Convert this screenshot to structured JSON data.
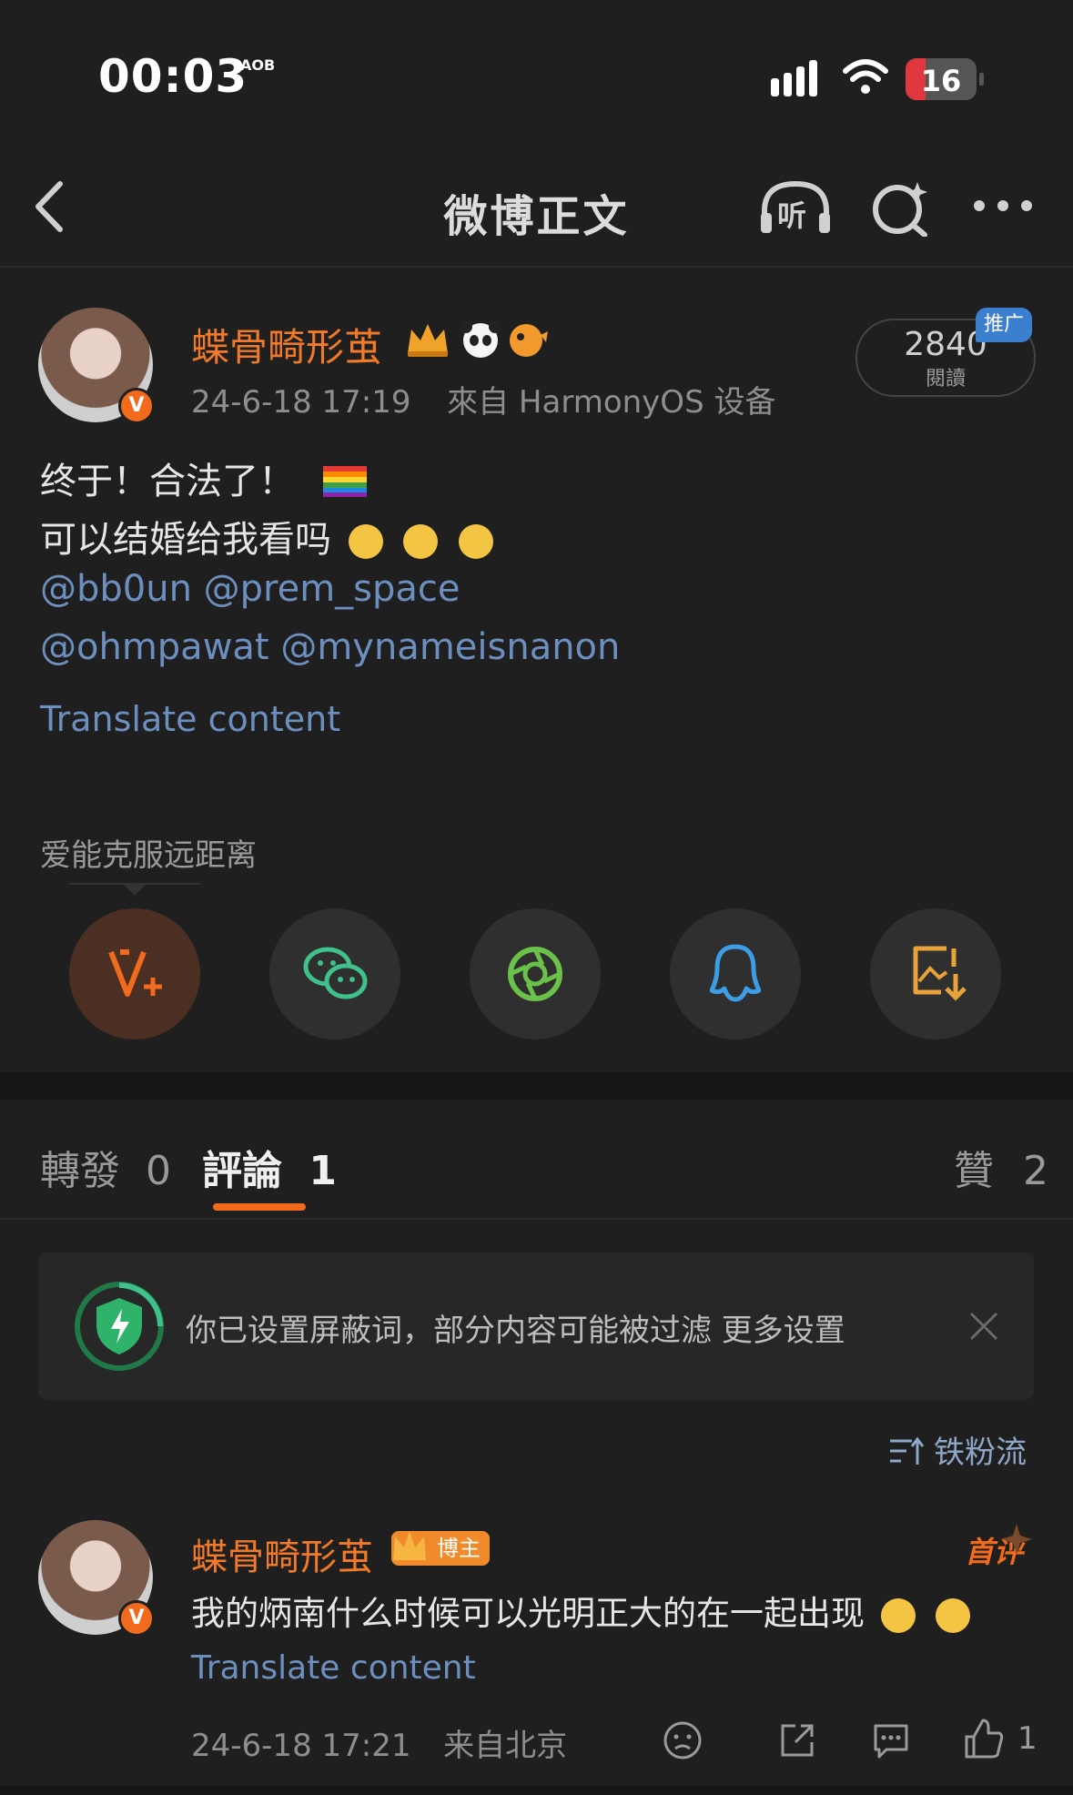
{
  "status_bar": {
    "time": "00:03",
    "time_tag": "AOB",
    "battery": "16",
    "battery_level": 0.16
  },
  "nav": {
    "title": "微博正文",
    "icons": [
      "back-chevron-icon",
      "listen-headphones-icon",
      "search-sparkle-icon",
      "more-dots-icon"
    ],
    "listen_label": "听"
  },
  "post": {
    "author": "蝶骨畸形茧",
    "author_badges": [
      "crown-badge-icon",
      "panda-icon",
      "pufferfish-icon"
    ],
    "timestamp": "24-6-18 17:19",
    "source": "來自 HarmonyOS 设备",
    "read_count": "2840",
    "read_label": "閱讀",
    "promo_label": "推广",
    "lines": [
      "终于！合法了！",
      "可以结婚给我看吗"
    ],
    "mentions_line1": "@bb0un @prem_space",
    "mentions_line2": "@ohmpawat @mynameisnanon",
    "translate": "Translate content"
  },
  "share": {
    "label": "爱能克服远距离",
    "buttons": [
      "weibo-vplus-icon",
      "wechat-icon",
      "moments-icon",
      "qq-icon",
      "save-image-icon"
    ],
    "vplus_color": "#f26b1d",
    "wechat_color": "#3ec18a",
    "moments_color": "#6ac24a",
    "qq_color": "#3d9ee6",
    "save_color": "#e8a23a"
  },
  "tabs": {
    "repost_label": "轉發",
    "repost_count": "0",
    "comment_label": "評論",
    "comment_count": "1",
    "like_label": "贊",
    "like_count": "2"
  },
  "notice": {
    "text": "你已设置屏蔽词，部分内容可能被过滤 更多设置"
  },
  "sort": {
    "label": "铁粉流"
  },
  "comment": {
    "author": "蝶骨畸形茧",
    "host_badge": "博主",
    "first_tag": "首评",
    "text": "我的炳南什么时候可以光明正大的在一起出现",
    "translate": "Translate content",
    "timestamp": "24-6-18 17:21",
    "source": "来自北京",
    "like_count": "1"
  }
}
